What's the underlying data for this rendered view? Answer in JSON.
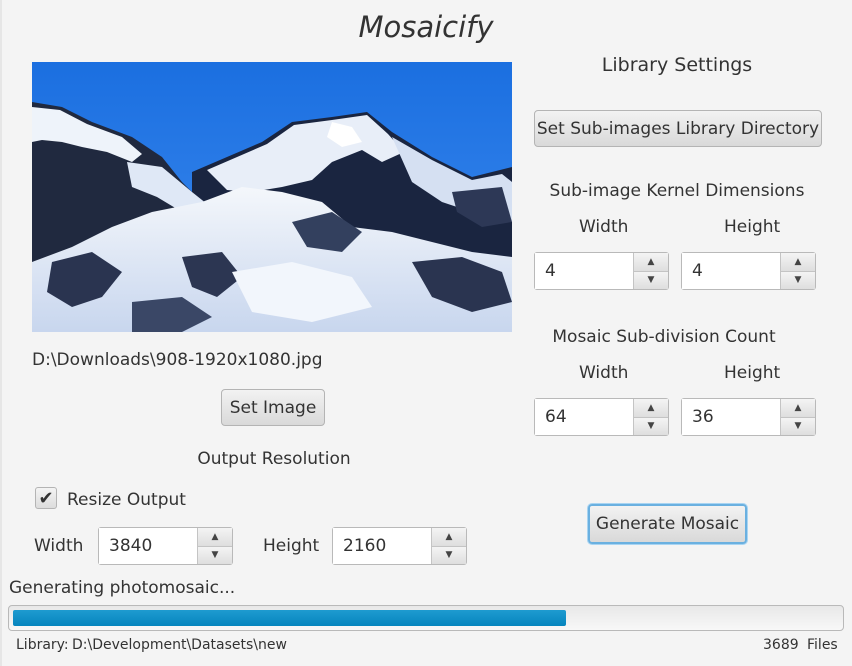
{
  "app": {
    "title": "Mosaicify"
  },
  "source": {
    "file_path": "D:\\Downloads\\908-1920x1080.jpg",
    "set_image_label": "Set Image"
  },
  "output": {
    "heading": "Output Resolution",
    "resize_label": "Resize Output",
    "resize_checked": true,
    "width_label": "Width",
    "width_value": "3840",
    "height_label": "Height",
    "height_value": "2160"
  },
  "library": {
    "heading": "Library Settings",
    "set_dir_label": "Set Sub-images Library Directory",
    "kernel_heading": "Sub-image Kernel Dimensions",
    "kernel_width_label": "Width",
    "kernel_height_label": "Height",
    "kernel_width_value": "4",
    "kernel_height_value": "4",
    "subdiv_heading": "Mosaic Sub-division Count",
    "subdiv_width_label": "Width",
    "subdiv_height_label": "Height",
    "subdiv_width_value": "64",
    "subdiv_height_value": "36"
  },
  "generate_label": "Generate Mosaic",
  "progress": {
    "status": "Generating photomosaic...",
    "fraction": 0.67
  },
  "statusbar": {
    "library_label": "Library:",
    "library_path": "D:\\Development\\Datasets\\new",
    "file_count": "3689",
    "files_label": "Files"
  },
  "colors": {
    "accent": "#0a8cc4",
    "focus": "#6ab0e0",
    "sky": "#1e73e6"
  },
  "icons": {
    "spin_up": "triangle-up",
    "spin_down": "triangle-down",
    "check": "check-mark"
  }
}
